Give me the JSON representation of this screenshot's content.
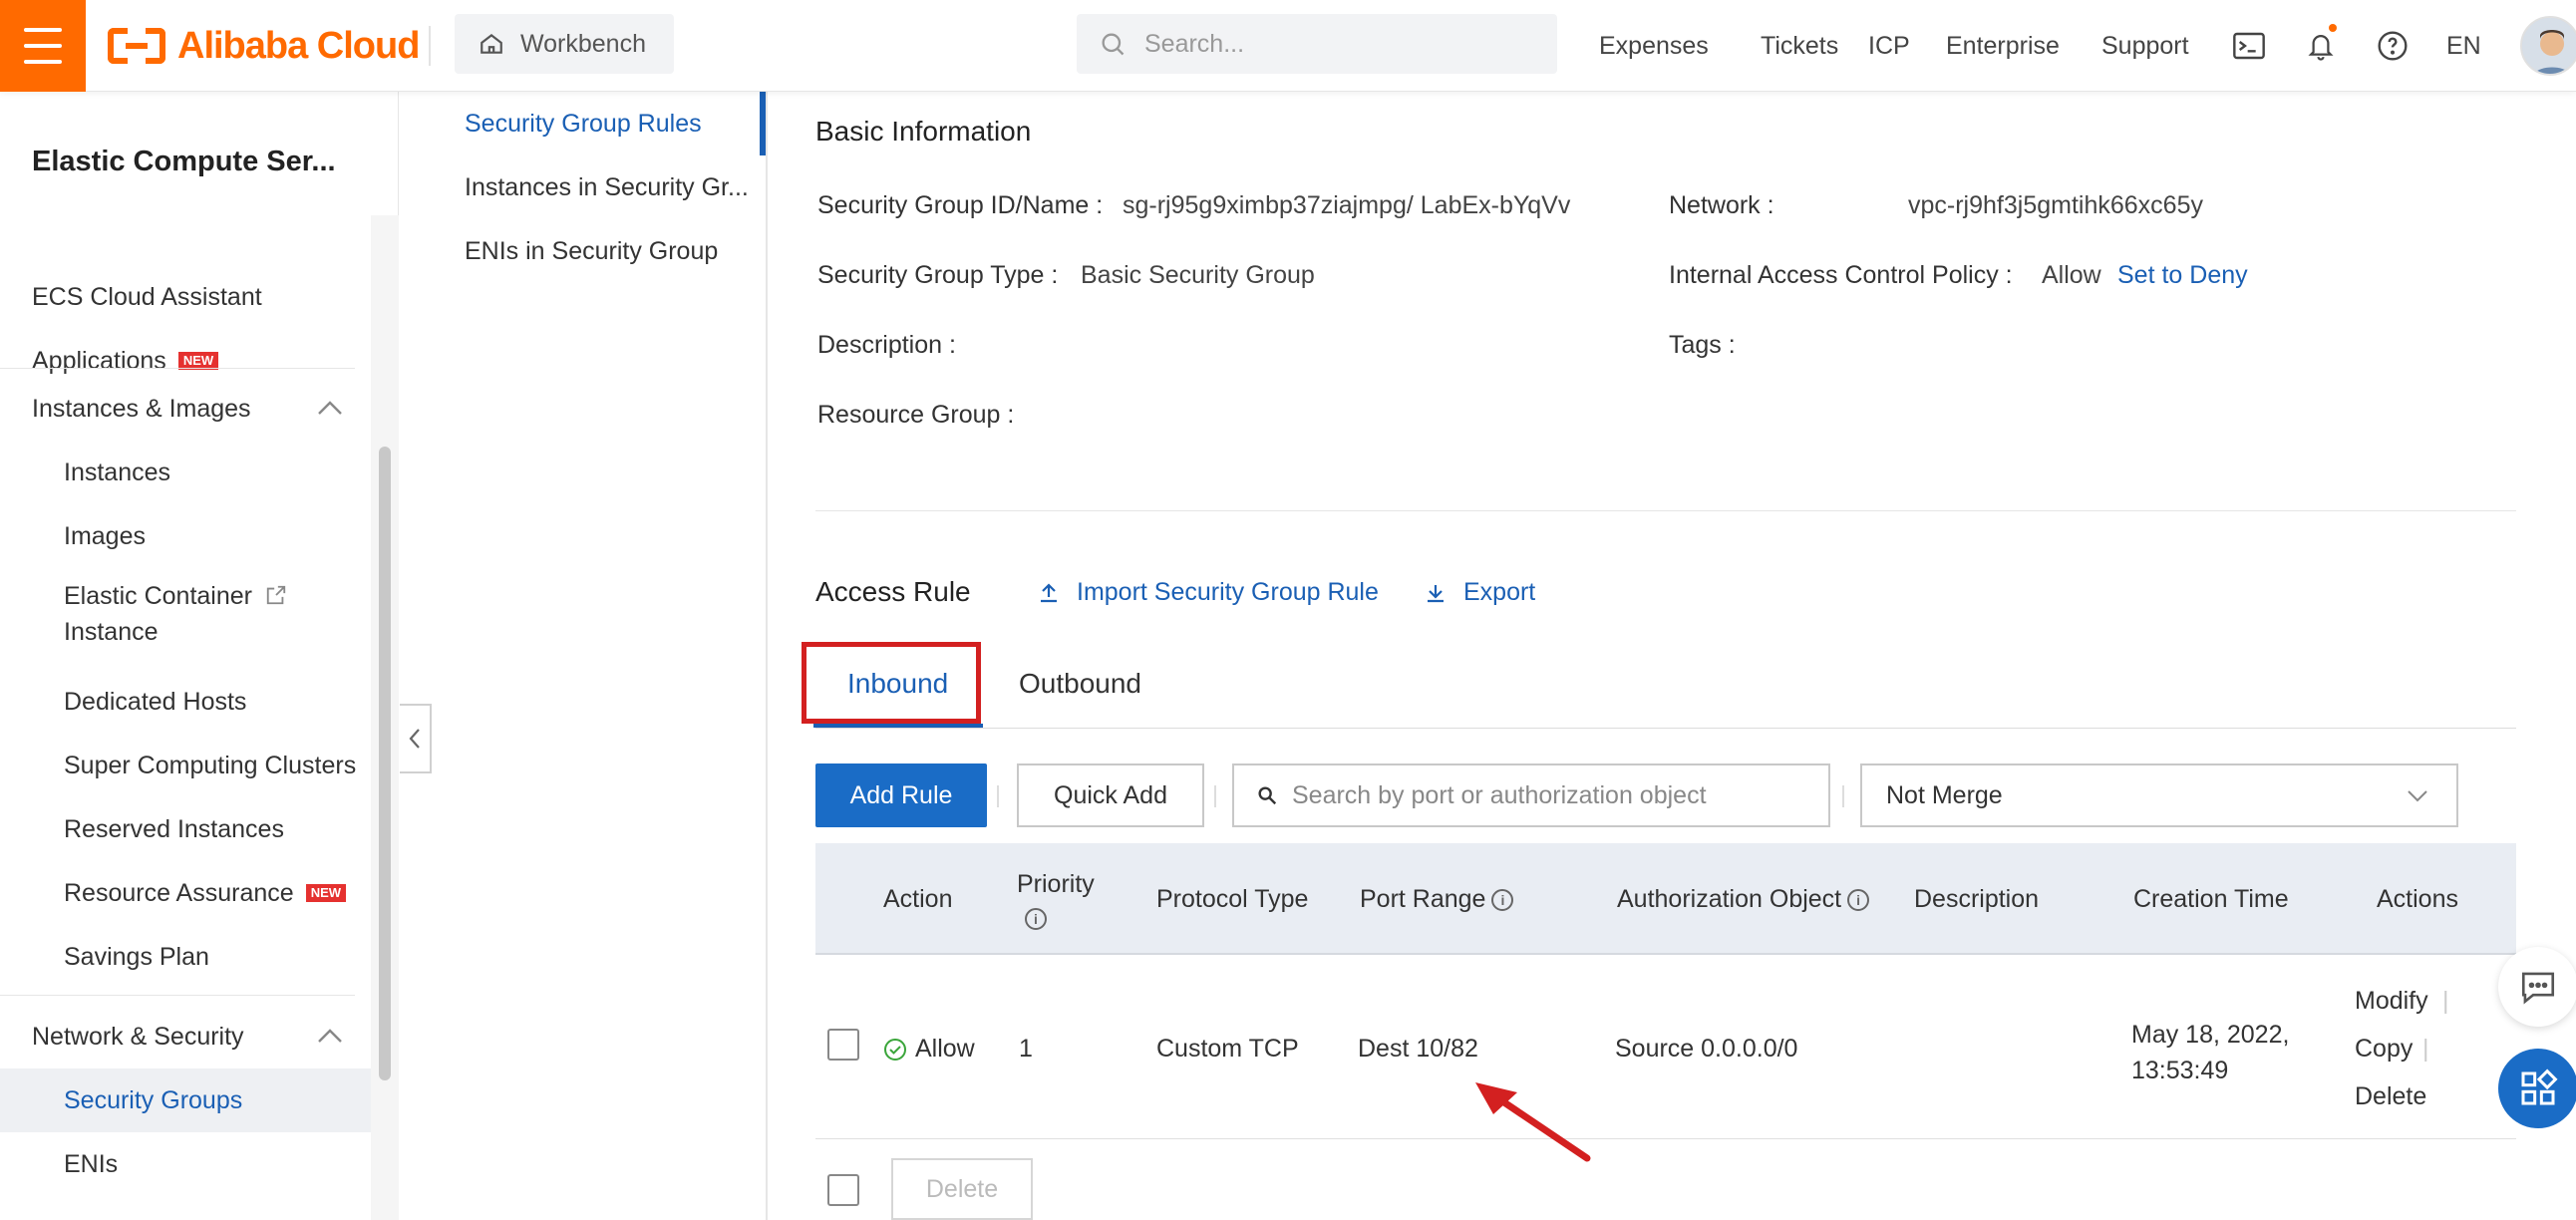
{
  "topbar": {
    "brand": "Alibaba Cloud",
    "workbench": "Workbench",
    "search_placeholder": "Search...",
    "nav": [
      "Expenses",
      "Tickets",
      "ICP",
      "Enterprise",
      "Support"
    ],
    "language": "EN",
    "accent_color": "#ff6a00"
  },
  "sidebar": {
    "title": "Elastic Compute Ser...",
    "items": [
      {
        "label": "ECS Cloud Assistant"
      },
      {
        "label": "Applications",
        "badge": "NEW"
      },
      {
        "label": "Instances & Images"
      },
      {
        "label": "Instances"
      },
      {
        "label": "Images"
      },
      {
        "label": "Elastic Container",
        "label2": "Instance"
      },
      {
        "label": "Dedicated Hosts"
      },
      {
        "label": "Super Computing Clusters"
      },
      {
        "label": "Reserved Instances"
      },
      {
        "label": "Resource Assurance",
        "badge": "NEW"
      },
      {
        "label": "Savings Plan"
      },
      {
        "label": "Network & Security"
      },
      {
        "label": "Security Groups"
      },
      {
        "label": "ENIs"
      }
    ]
  },
  "subnav": {
    "items": [
      "Security Group Rules",
      "Instances in Security Gr...",
      "ENIs in Security Group"
    ]
  },
  "basic_info": {
    "title": "Basic Information",
    "sg_id_label": "Security Group ID/Name :",
    "sg_id_value": "sg-rj95g9ximbp37ziajmpg/ LabEx-bYqVv",
    "network_label": "Network :",
    "network_value": "vpc-rj9hf3j5gmtihk66xc65y",
    "type_label": "Security Group Type :",
    "type_value": "Basic Security Group",
    "policy_label": "Internal Access Control Policy :",
    "policy_value": "Allow",
    "policy_link": "Set to Deny",
    "description_label": "Description :",
    "tags_label": "Tags :",
    "resource_group_label": "Resource Group :"
  },
  "access_rule": {
    "title": "Access Rule",
    "import_label": "Import Security Group Rule",
    "export_label": "Export",
    "tabs": [
      "Inbound",
      "Outbound"
    ],
    "add_rule": "Add Rule",
    "quick_add": "Quick Add",
    "search_placeholder": "Search by port or authorization object",
    "merge_select": "Not Merge",
    "columns": [
      "Action",
      "Priority",
      "Protocol Type",
      "Port Range",
      "Authorization Object",
      "Description",
      "Creation Time",
      "Actions"
    ],
    "rows": [
      {
        "action": "Allow",
        "priority": "1",
        "protocol": "Custom TCP",
        "port_range": "Dest 10/82",
        "auth_object": "Source 0.0.0.0/0",
        "description": "",
        "creation_date": "May 18, 2022,",
        "creation_time": "13:53:49",
        "actions": [
          "Modify",
          "Copy",
          "Delete"
        ]
      }
    ],
    "bulk_delete": "Delete"
  }
}
